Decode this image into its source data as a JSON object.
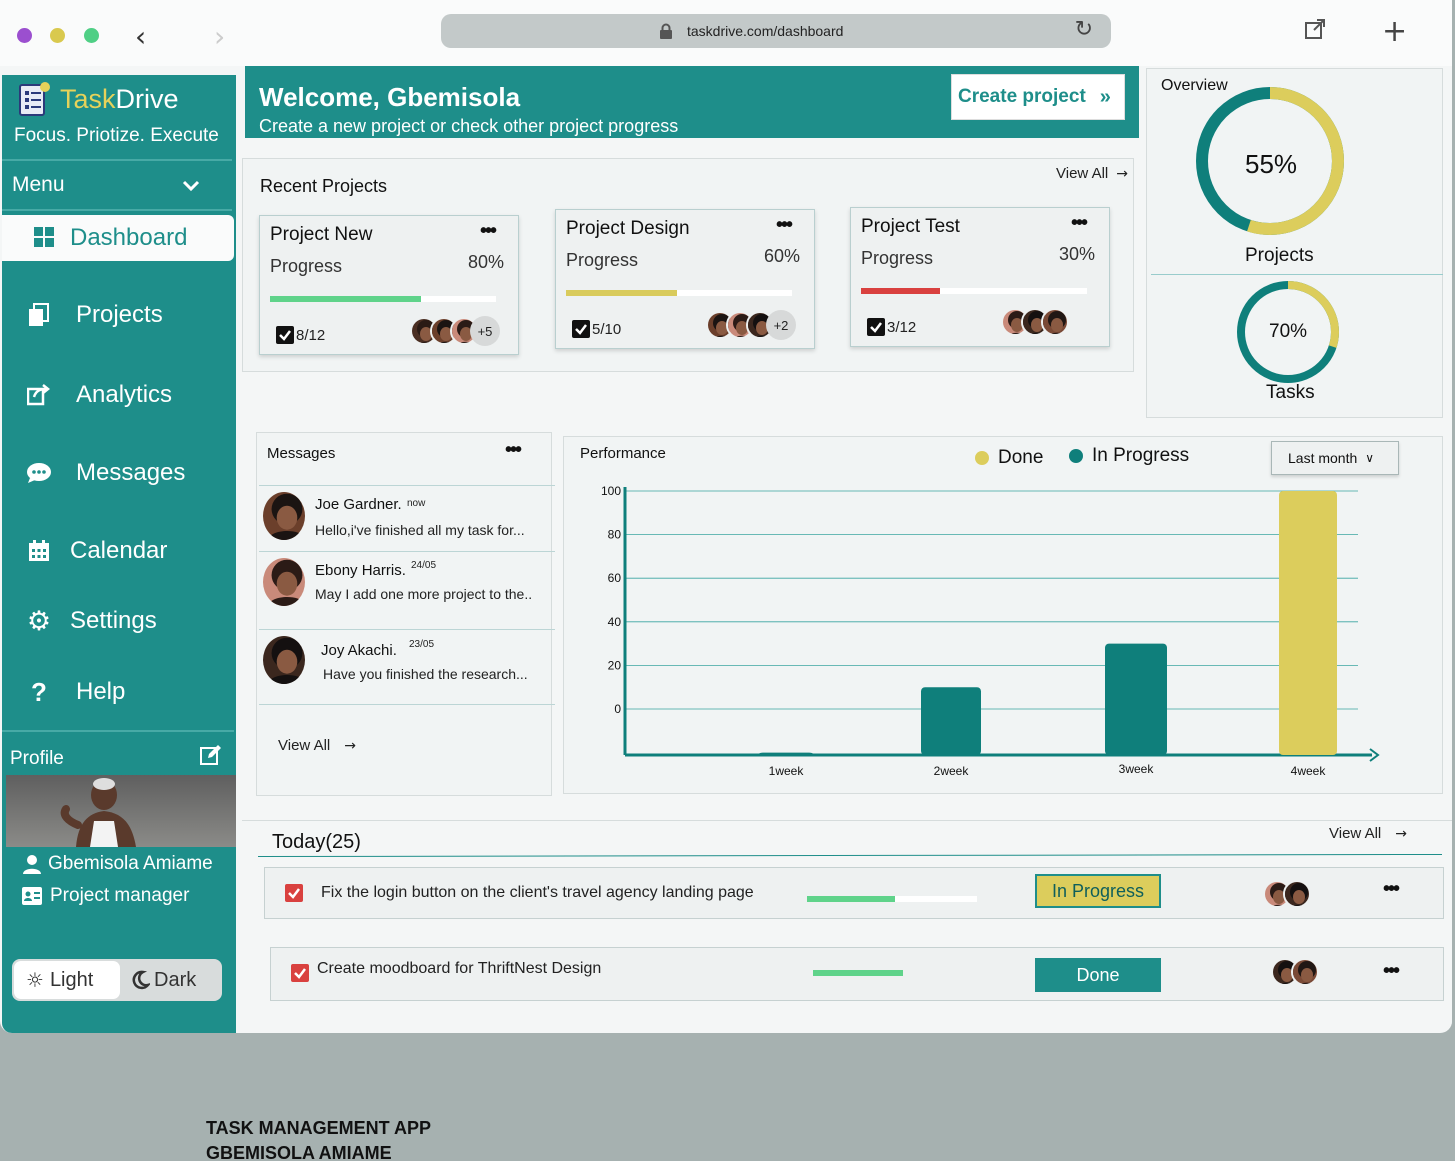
{
  "browser": {
    "url": "taskdrive.com/dashboard",
    "dot_colors": [
      "#9b4fcf",
      "#d9c94e",
      "#4fcf85"
    ]
  },
  "sidebar": {
    "brand_part1": "Task",
    "brand_part2": "Drive",
    "tagline": "Focus. Priotize. Execute",
    "menu_label": "Menu",
    "active_item": "Dashboard",
    "items": [
      {
        "label": "Projects",
        "icon": "files-icon"
      },
      {
        "label": "Analytics",
        "icon": "share-icon"
      },
      {
        "label": "Messages",
        "icon": "chat-icon"
      },
      {
        "label": "Calendar",
        "icon": "calendar-icon"
      },
      {
        "label": "Settings",
        "icon": "gear-icon"
      },
      {
        "label": "Help",
        "icon": "help-icon"
      }
    ],
    "profile_label": "Profile",
    "profile_name": "Gbemisola Amiame",
    "profile_role": "Project manager",
    "theme_light": "Light",
    "theme_dark": "Dark",
    "accent": "#1e8e8a"
  },
  "welcome": {
    "title": "Welcome, Gbemisola",
    "subtitle": "Create a new project or check other project progress",
    "create_button": "Create project"
  },
  "recent_projects": {
    "title": "Recent Projects",
    "view_all": "View All",
    "progress_label": "Progress",
    "projects": [
      {
        "name": "Project New",
        "progress_text": "80%",
        "progress": 0.67,
        "color": "#5fd38a",
        "tasks": "8/12",
        "more": "+5"
      },
      {
        "name": "Project Design",
        "progress_text": "60%",
        "progress": 0.49,
        "color": "#d9cb5c",
        "tasks": "5/10",
        "more": "+2"
      },
      {
        "name": "Project Test",
        "progress_text": "30%",
        "progress": 0.35,
        "color": "#d9413f",
        "tasks": "3/12",
        "more": ""
      }
    ]
  },
  "overview": {
    "title": "Overview",
    "projects_pct_text": "55%",
    "projects_label": "Projects",
    "projects_pct": 0.55,
    "tasks_pct_text": "70%",
    "tasks_label": "Tasks",
    "tasks_pct": 0.3
  },
  "messages": {
    "title": "Messages",
    "view_all": "View All",
    "items": [
      {
        "name": "Joe Gardner.",
        "time": "now",
        "text": "Hello,i've finished all my task for..."
      },
      {
        "name": "Ebony Harris.",
        "time": "24/05",
        "text": "May I add one more project to the.."
      },
      {
        "name": "Joy Akachi.",
        "time": "23/05",
        "text": "Have you finished the research..."
      }
    ]
  },
  "performance": {
    "title": "Performance",
    "period": "Last month",
    "legend_done": "Done",
    "legend_in_progress": "In Progress",
    "done_color": "#dccd5c",
    "in_progress_color": "#0f7f7b"
  },
  "chart_data": {
    "type": "bar",
    "categories": [
      "1week",
      "2week",
      "3week",
      "4week"
    ],
    "series": [
      {
        "name": "In Progress",
        "values": [
          -20,
          10,
          30,
          null
        ]
      },
      {
        "name": "Done",
        "values": [
          null,
          null,
          null,
          100
        ]
      }
    ],
    "yticks": [
      0,
      20,
      40,
      60,
      80,
      100
    ],
    "title": "Performance",
    "grid": true,
    "legend": "top"
  },
  "today": {
    "title": "Today(25)",
    "view_all": "View All",
    "tasks": [
      {
        "text": "Fix the login button on the client's travel agency landing page",
        "progress": 0.52,
        "status": "In Progress"
      },
      {
        "text": "Create moodboard for ThriftNest Design",
        "progress": 1.0,
        "status": "Done"
      }
    ]
  },
  "credit": {
    "line1": "TASK MANAGEMENT APP",
    "line2": "GBEMISOLA AMIAME"
  }
}
